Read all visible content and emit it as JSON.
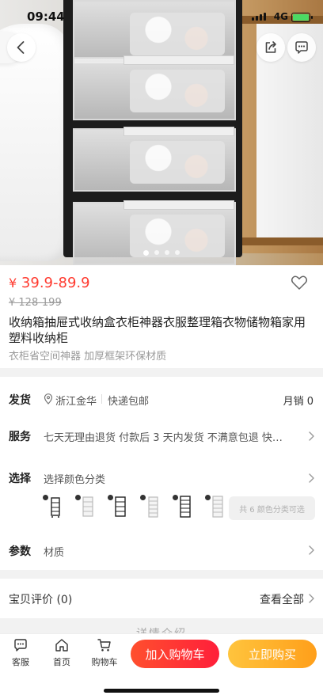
{
  "status_bar": {
    "time": "09:44",
    "network": "4G"
  },
  "hero": {
    "image_dots": 4,
    "active_dot": 1
  },
  "product": {
    "price_symbol": "¥",
    "price": "39.9-89.9",
    "original_price": "¥ 128-199",
    "title": "收纳箱抽屉式收纳盒衣柜神器衣服整理箱衣物储物箱家用塑料收纳柜",
    "subtitle": "衣柜省空间神器 加厚框架环保材质"
  },
  "shipping": {
    "label": "发货",
    "location": "浙江金华",
    "method": "快递包邮",
    "monthly_sales": "月销 0"
  },
  "service": {
    "label": "服务",
    "text": "七天无理由退货 付款后 3 天内发货 不满意包退 快…"
  },
  "selection": {
    "label": "选择",
    "text": "选择颜色分类",
    "variant_count": 6,
    "more_text": "共 6 颜色分类可选"
  },
  "params": {
    "label": "参数",
    "text": "材质"
  },
  "reviews": {
    "label": "宝贝评价 (0)",
    "view_all": "查看全部"
  },
  "detail_peek": "详情介绍",
  "bottom_bar": {
    "service": "客服",
    "home": "首页",
    "cart": "购物车",
    "add_to_cart": "加入购物车",
    "buy_now": "立即购买"
  },
  "colors": {
    "price": "#ff3b30",
    "cart_button": "#ff2f3a",
    "buy_button": "#ffa51f"
  }
}
